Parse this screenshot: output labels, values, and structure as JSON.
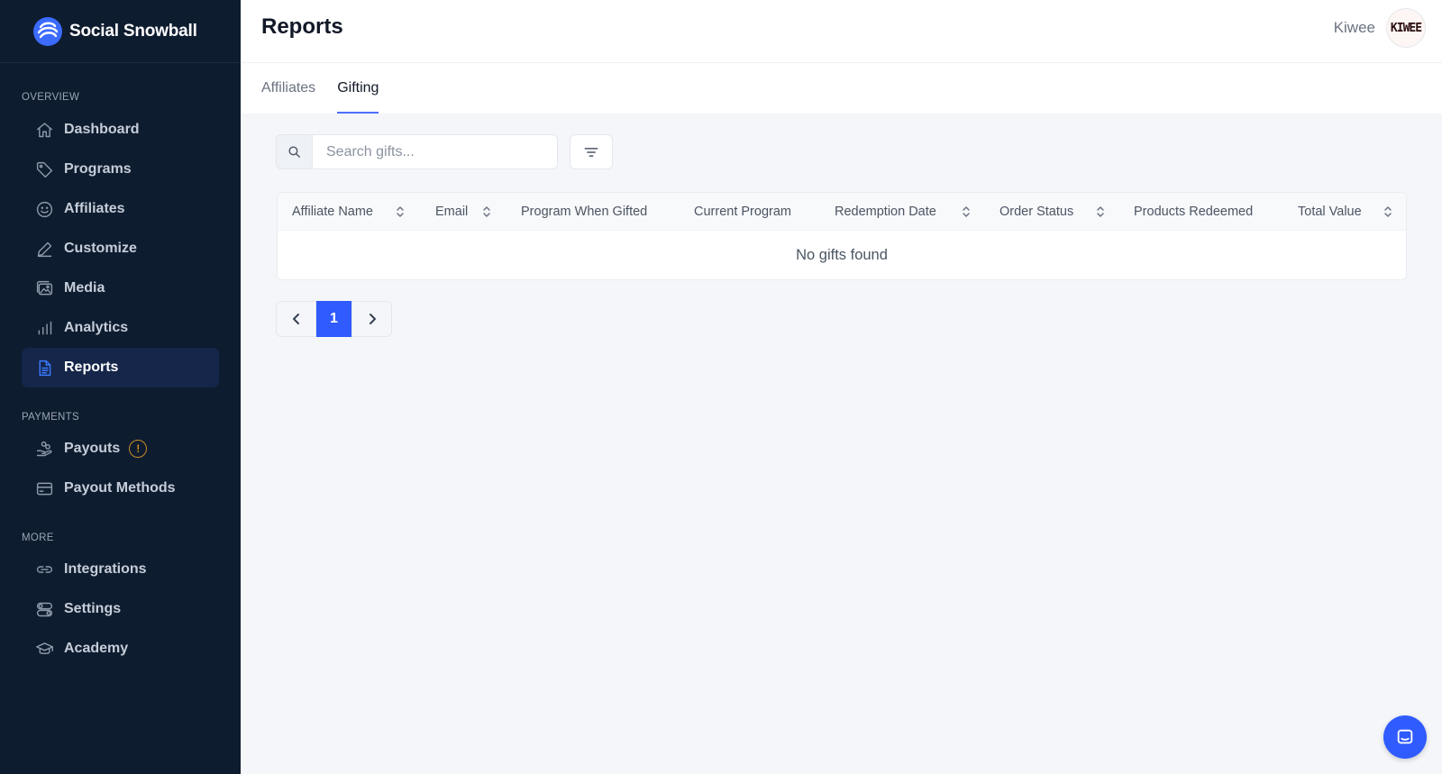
{
  "brand": {
    "name": "Social Snowball",
    "logo_icon": "snowball-logo-icon"
  },
  "sidebar": {
    "sections": [
      {
        "label": "OVERVIEW",
        "items": [
          {
            "label": "Dashboard",
            "icon": "home-icon"
          },
          {
            "label": "Programs",
            "icon": "tag-icon"
          },
          {
            "label": "Affiliates",
            "icon": "smiley-icon"
          },
          {
            "label": "Customize",
            "icon": "pencil-icon"
          },
          {
            "label": "Media",
            "icon": "images-icon"
          },
          {
            "label": "Analytics",
            "icon": "bar-chart-icon"
          },
          {
            "label": "Reports",
            "icon": "document-icon",
            "active": true
          }
        ]
      },
      {
        "label": "PAYMENTS",
        "items": [
          {
            "label": "Payouts",
            "icon": "hand-coins-icon",
            "badge": "!"
          },
          {
            "label": "Payout Methods",
            "icon": "credit-card-icon"
          }
        ]
      },
      {
        "label": "MORE",
        "items": [
          {
            "label": "Integrations",
            "icon": "link-icon"
          },
          {
            "label": "Settings",
            "icon": "toggles-icon"
          },
          {
            "label": "Academy",
            "icon": "graduation-cap-icon"
          }
        ]
      }
    ]
  },
  "header": {
    "title": "Reports",
    "account_name": "Kiwee",
    "avatar_text": "KIWEE"
  },
  "tabs": [
    {
      "label": "Affiliates",
      "active": false
    },
    {
      "label": "Gifting",
      "active": true
    }
  ],
  "search": {
    "placeholder": "Search gifts...",
    "value": ""
  },
  "table": {
    "columns": [
      {
        "label": "Affiliate Name",
        "sortable": true
      },
      {
        "label": "Email",
        "sortable": true
      },
      {
        "label": "Program When Gifted",
        "sortable": false
      },
      {
        "label": "Current Program",
        "sortable": false
      },
      {
        "label": "Redemption Date",
        "sortable": true
      },
      {
        "label": "Order Status",
        "sortable": true
      },
      {
        "label": "Products Redeemed",
        "sortable": false
      },
      {
        "label": "Total Value",
        "sortable": true
      }
    ],
    "rows": [],
    "empty_message": "No gifts found"
  },
  "pagination": {
    "current_page": "1"
  },
  "colors": {
    "sidebar_bg": "#0e1c2f",
    "active_nav_bg": "#15264a",
    "accent": "#2f5bff",
    "warning": "#c98b28"
  }
}
